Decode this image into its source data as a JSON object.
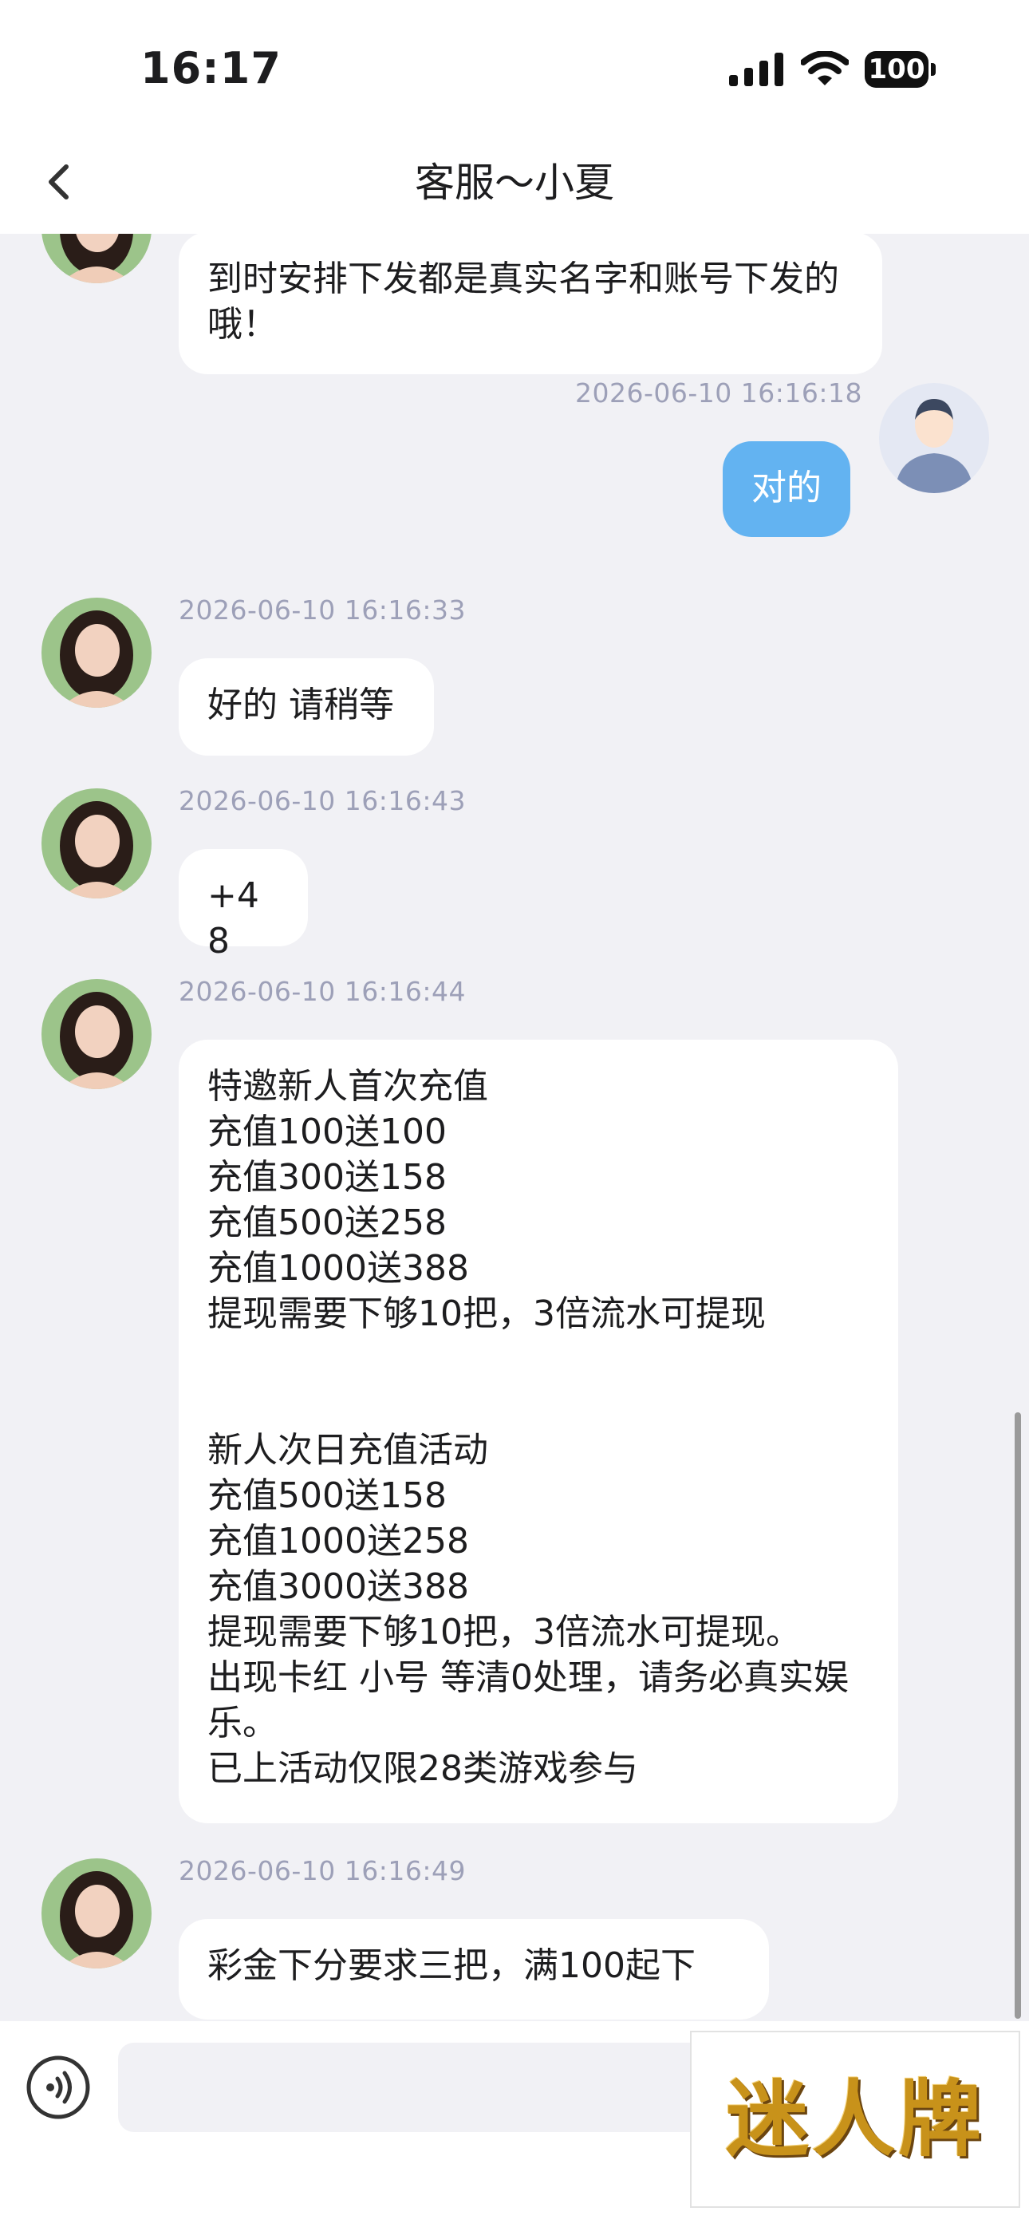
{
  "status_bar": {
    "time": "16:17",
    "battery": "100"
  },
  "nav": {
    "title": "客服～小夏"
  },
  "messages": [
    {
      "text": "到时安排下发都是真实名字和账号下发的哦！"
    },
    {
      "timestamp": "2026-06-10 16:16:18",
      "text": "对的"
    },
    {
      "timestamp": "2026-06-10 16:16:33",
      "text": "好的 请稍等"
    },
    {
      "timestamp": "2026-06-10 16:16:43",
      "text": "+48"
    },
    {
      "timestamp": "2026-06-10 16:16:44",
      "text": "特邀新人首次充值\n充值100送100\n充值300送158\n充值500送258\n充值1000送388\n提现需要下够10把，3倍流水可提现\n\n\n新人次日充值活动\n充值500送158\n充值1000送258\n充值3000送388\n提现需要下够10把，3倍流水可提现。\n出现卡红 小号 等清0处理，请务必真实娱乐。\n已上活动仅限28类游戏参与"
    },
    {
      "timestamp": "2026-06-10 16:16:49",
      "text": "彩金下分要求三把，满100起下"
    }
  ],
  "input": {
    "placeholder": ""
  },
  "watermark": "迷人牌",
  "colors": {
    "sent_bubble": "#63b3f1",
    "background": "#f1f1f5",
    "timestamp": "#9da0b8"
  }
}
